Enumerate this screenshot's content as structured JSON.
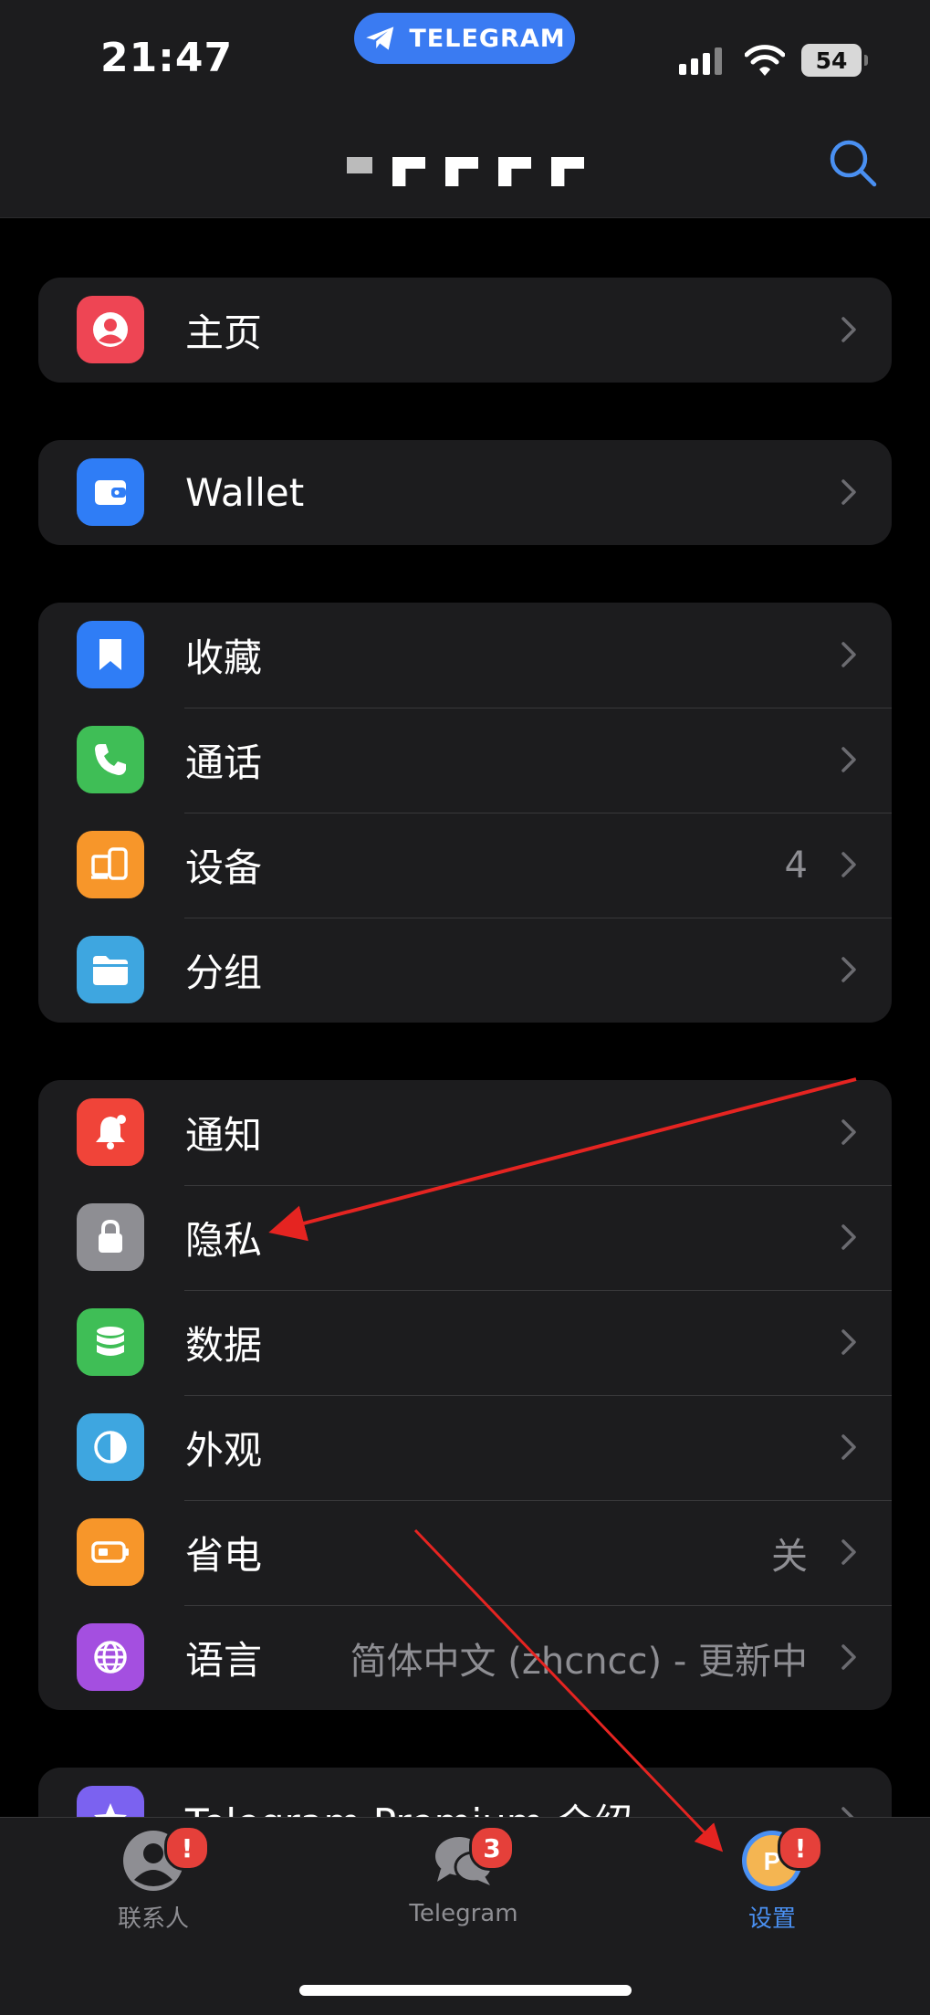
{
  "status_bar": {
    "time": "21:47",
    "app_pill": "TELEGRAM",
    "battery": "54"
  },
  "header": {
    "search_icon": "search-icon"
  },
  "groups": [
    {
      "items": [
        {
          "label": "主页",
          "value": "",
          "icon": "profile-icon",
          "color": "#ee4554"
        }
      ]
    },
    {
      "items": [
        {
          "label": "Wallet",
          "value": "",
          "icon": "wallet-icon",
          "color": "#2f7df6"
        }
      ]
    },
    {
      "items": [
        {
          "label": "收藏",
          "value": "",
          "icon": "bookmark-icon",
          "color": "#2f7df6"
        },
        {
          "label": "通话",
          "value": "",
          "icon": "phone-icon",
          "color": "#3fbe56"
        },
        {
          "label": "设备",
          "value": "4",
          "icon": "devices-icon",
          "color": "#f7962a"
        },
        {
          "label": "分组",
          "value": "",
          "icon": "folder-icon",
          "color": "#3ea6e0"
        }
      ]
    },
    {
      "items": [
        {
          "label": "通知",
          "value": "",
          "icon": "bell-icon",
          "color": "#f04439"
        },
        {
          "label": "隐私",
          "value": "",
          "icon": "lock-icon",
          "color": "#8e8e93"
        },
        {
          "label": "数据",
          "value": "",
          "icon": "database-icon",
          "color": "#3fbe56"
        },
        {
          "label": "外观",
          "value": "",
          "icon": "appearance-icon",
          "color": "#3ea6e0"
        },
        {
          "label": "省电",
          "value": "关",
          "icon": "battery-icon",
          "color": "#f7962a"
        },
        {
          "label": "语言",
          "value": "简体中文 (zhcncc) - 更新中",
          "icon": "globe-icon",
          "color": "#a44fe0"
        }
      ]
    },
    {
      "items": [
        {
          "label": "Telegram Premium 介绍",
          "value": "",
          "icon": "star-icon",
          "color": "#7b62f0"
        }
      ]
    }
  ],
  "tabbar": {
    "tabs": [
      {
        "label": "联系人",
        "badge": "!",
        "active": false
      },
      {
        "label": "Telegram",
        "badge": "3",
        "active": false
      },
      {
        "label": "设置",
        "badge": "!",
        "active": true,
        "avatar_letter": "P"
      }
    ]
  },
  "colors": {
    "accent": "#4a90f2",
    "badge": "#e5403a",
    "annotation_arrow": "#e52421"
  }
}
